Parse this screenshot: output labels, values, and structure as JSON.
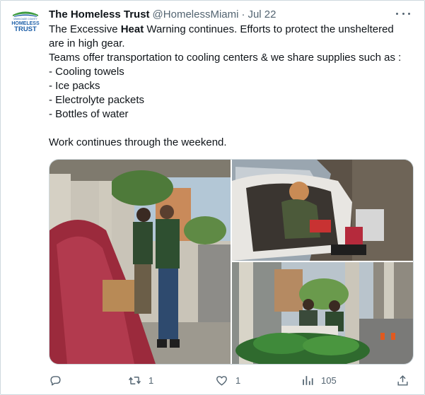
{
  "tweet": {
    "author_name": "The Homeless Trust",
    "handle": "@HomelessMiami",
    "separator": "·",
    "date": "Jul 22",
    "avatar": {
      "logo_lines": [
        "MIAMI-DADE COUNTY",
        "HOMELESS",
        "TRUST"
      ],
      "colors": {
        "green": "#3d9b3f",
        "blue": "#1d5fa8"
      }
    },
    "text_lines": [
      {
        "pre": "The Excessive ",
        "bold": "Heat",
        "post": " Warning continues. Efforts to protect the unsheltered"
      },
      {
        "pre": "are in high gear.",
        "bold": "",
        "post": ""
      },
      {
        "pre": "Teams offer transportation to cooling centers & we share supplies such as :",
        "bold": "",
        "post": ""
      },
      {
        "pre": "- Cooling towels",
        "bold": "",
        "post": ""
      },
      {
        "pre": "- Ice packs",
        "bold": "",
        "post": ""
      },
      {
        "pre": "- Electrolyte packets",
        "bold": "",
        "post": ""
      },
      {
        "pre": "- Bottles of water",
        "bold": "",
        "post": ""
      },
      {
        "pre": "",
        "bold": "",
        "post": ""
      },
      {
        "pre": "Work continues through the weekend.",
        "bold": "",
        "post": ""
      }
    ],
    "media_icons": [
      "photo-outreach-tent",
      "photo-woman-in-tent",
      "photo-sidewalk-outreach"
    ]
  },
  "actions": {
    "reply": {
      "icon": "reply-icon",
      "count": ""
    },
    "retweet": {
      "icon": "retweet-icon",
      "count": "1"
    },
    "like": {
      "icon": "heart-icon",
      "count": "1"
    },
    "views": {
      "icon": "views-icon",
      "count": "105"
    },
    "share": {
      "icon": "share-icon",
      "count": ""
    }
  },
  "colors": {
    "text": "#0f1419",
    "muted": "#536471",
    "border": "#cfd9de"
  }
}
